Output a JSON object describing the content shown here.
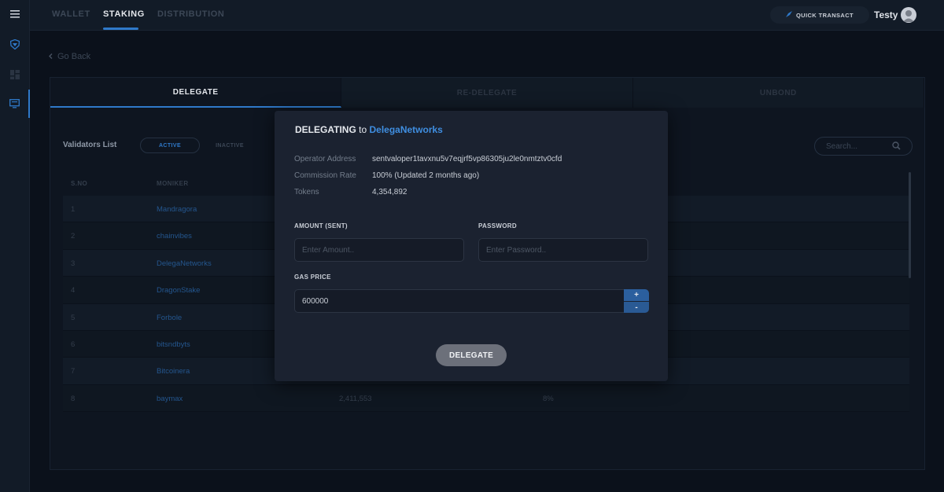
{
  "topbar": {
    "tabs": [
      {
        "label": "WALLET",
        "active": false
      },
      {
        "label": "STAKING",
        "active": true
      },
      {
        "label": "DISTRIBUTION",
        "active": false
      }
    ],
    "quick_transact_label": "QUICK TRANSACT",
    "user_name": "Testy"
  },
  "nav": {
    "menu_icon": "hamburger-icon",
    "items": [
      {
        "icon": "shield-icon",
        "active": false
      },
      {
        "icon": "dashboard-icon",
        "active": false
      },
      {
        "icon": "monitor-icon",
        "active": true
      }
    ]
  },
  "page": {
    "go_back_label": "Go Back",
    "op_tabs": [
      {
        "label": "DELEGATE",
        "active": true
      },
      {
        "label": "RE-DELEGATE",
        "active": false
      },
      {
        "label": "UNBOND",
        "active": false
      }
    ],
    "validators_title": "Validators List",
    "filter_active": "ACTIVE",
    "filter_inactive": "INACTIVE",
    "search_placeholder": "Search...",
    "table": {
      "headers": {
        "sno": "S.NO",
        "moniker": "MONIKER"
      },
      "rows": [
        {
          "sno": "1",
          "moniker": "Mandragora",
          "tokens": "",
          "commission": ""
        },
        {
          "sno": "2",
          "moniker": "chainvibes",
          "tokens": "",
          "commission": ""
        },
        {
          "sno": "3",
          "moniker": "DelegaNetworks",
          "tokens": "",
          "commission": ""
        },
        {
          "sno": "4",
          "moniker": "DragonStake",
          "tokens": "",
          "commission": ""
        },
        {
          "sno": "5",
          "moniker": "Forbole",
          "tokens": "",
          "commission": ""
        },
        {
          "sno": "6",
          "moniker": "bitsndbyts",
          "tokens": "",
          "commission": ""
        },
        {
          "sno": "7",
          "moniker": "Bitcoinera",
          "tokens": "",
          "commission": ""
        },
        {
          "sno": "8",
          "moniker": "baymax",
          "tokens": "2,411,553",
          "commission": "8%"
        }
      ]
    }
  },
  "modal": {
    "title_prefix": "DELEGATING",
    "title_to": "to",
    "validator_name": "DelegaNetworks",
    "info": [
      {
        "key": "Operator Address",
        "value": "sentvaloper1tavxnu5v7eqjrf5vp86305ju2le0nmtztv0cfd"
      },
      {
        "key": "Commission Rate",
        "value": "100% (Updated 2 months ago)"
      },
      {
        "key": "Tokens",
        "value": "4,354,892"
      }
    ],
    "amount_label": "AMOUNT (SENT)",
    "amount_placeholder": "Enter Amount..",
    "password_label": "PASSWORD",
    "password_placeholder": "Enter Password..",
    "gas_label": "GAS PRICE",
    "gas_value": "600000",
    "plus": "+",
    "minus": "-",
    "submit_label": "DELEGATE"
  },
  "colors": {
    "accent": "#2f79c9",
    "highlight": "#3f8ee0",
    "background": "#0b111b",
    "modal": "#1b2230"
  }
}
